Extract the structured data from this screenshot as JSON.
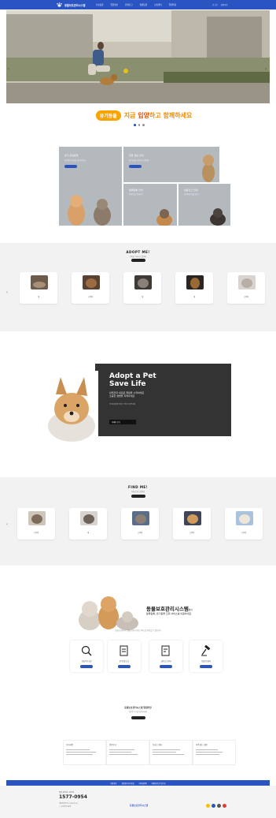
{
  "header": {
    "logo_text": "동물보호관리시스템",
    "nav": [
      "보호동물",
      "입양정보",
      "유실신고",
      "실종동물",
      "보호센터",
      "알림마당"
    ],
    "util": [
      "로그인",
      "회원가입"
    ]
  },
  "hero": {
    "banner_badge": "유기동물",
    "banner_text_pre": "지금 ",
    "banner_text_em": "입양",
    "banner_text_post": "하고 함께하세요",
    "slide_count": 3,
    "active_slide": 1
  },
  "grid_cards": [
    {
      "title": "유기·유실동물",
      "sub": "보호중인 동물을 확인하세요"
    },
    {
      "title": "입양 정보 안내",
      "sub": "새 가족을 기다리고 있어요"
    },
    {
      "title": "동물등록 안내",
      "sub": "반려동물 등록하기"
    },
    {
      "title": "실종신고 안내",
      "sub": "잃어버린 동물 찾기"
    }
  ],
  "adopt": {
    "title": "ADOPT ME!",
    "sub": "가족을 기다리고 있어요",
    "items": [
      "개",
      "고양이",
      "개",
      "개",
      "고양이"
    ]
  },
  "promo": {
    "title_line1": "Adopt a Pet",
    "title_line2": "Save Life",
    "sub1": "반려견과 새로운 행복을 시작하세요",
    "sub2": "소중한 생명을 지켜주세요",
    "small": "유기동물에게 따뜻한 가족이 되어주세요",
    "button": "자세히 보기"
  },
  "find": {
    "title": "FIND ME!",
    "sub": "가족을 찾고 있어요",
    "items": [
      "고양이",
      "개",
      "고양이",
      "고양이",
      "고양이"
    ]
  },
  "system": {
    "title": "동물보호관리시스템",
    "title_suffix": "에서",
    "line": "동물등록, 유기동물 조회 서비스를 이용하세요",
    "small": "동물보호관리시스템을 통해 다양한 서비스를 이용할 수 있습니다",
    "services": [
      "동물등록 조회",
      "유기동물 공고",
      "실종신고 안내",
      "동물보호센터"
    ]
  },
  "notice": {
    "title": "동물보호관리시스템 알림마당",
    "sub": "새로운 소식을 확인하세요",
    "boards": [
      "공지사항",
      "입양후기",
      "보호소 안내",
      "자주 묻는 질문"
    ]
  },
  "footer": {
    "bar_links": [
      "이용약관",
      "개인정보처리방침",
      "저작권정책",
      "이메일무단수집거부"
    ],
    "phone": "1577-0954",
    "hours": "평일 09:00~18:00",
    "addr": "세종특별자치시 다솜2로 94",
    "copy": "© 농림축산식품부",
    "logo_text": "동물보호관리시스템"
  },
  "colors": {
    "brand": "#2a54c2",
    "accent": "#f7a400",
    "dark": "#333333"
  }
}
